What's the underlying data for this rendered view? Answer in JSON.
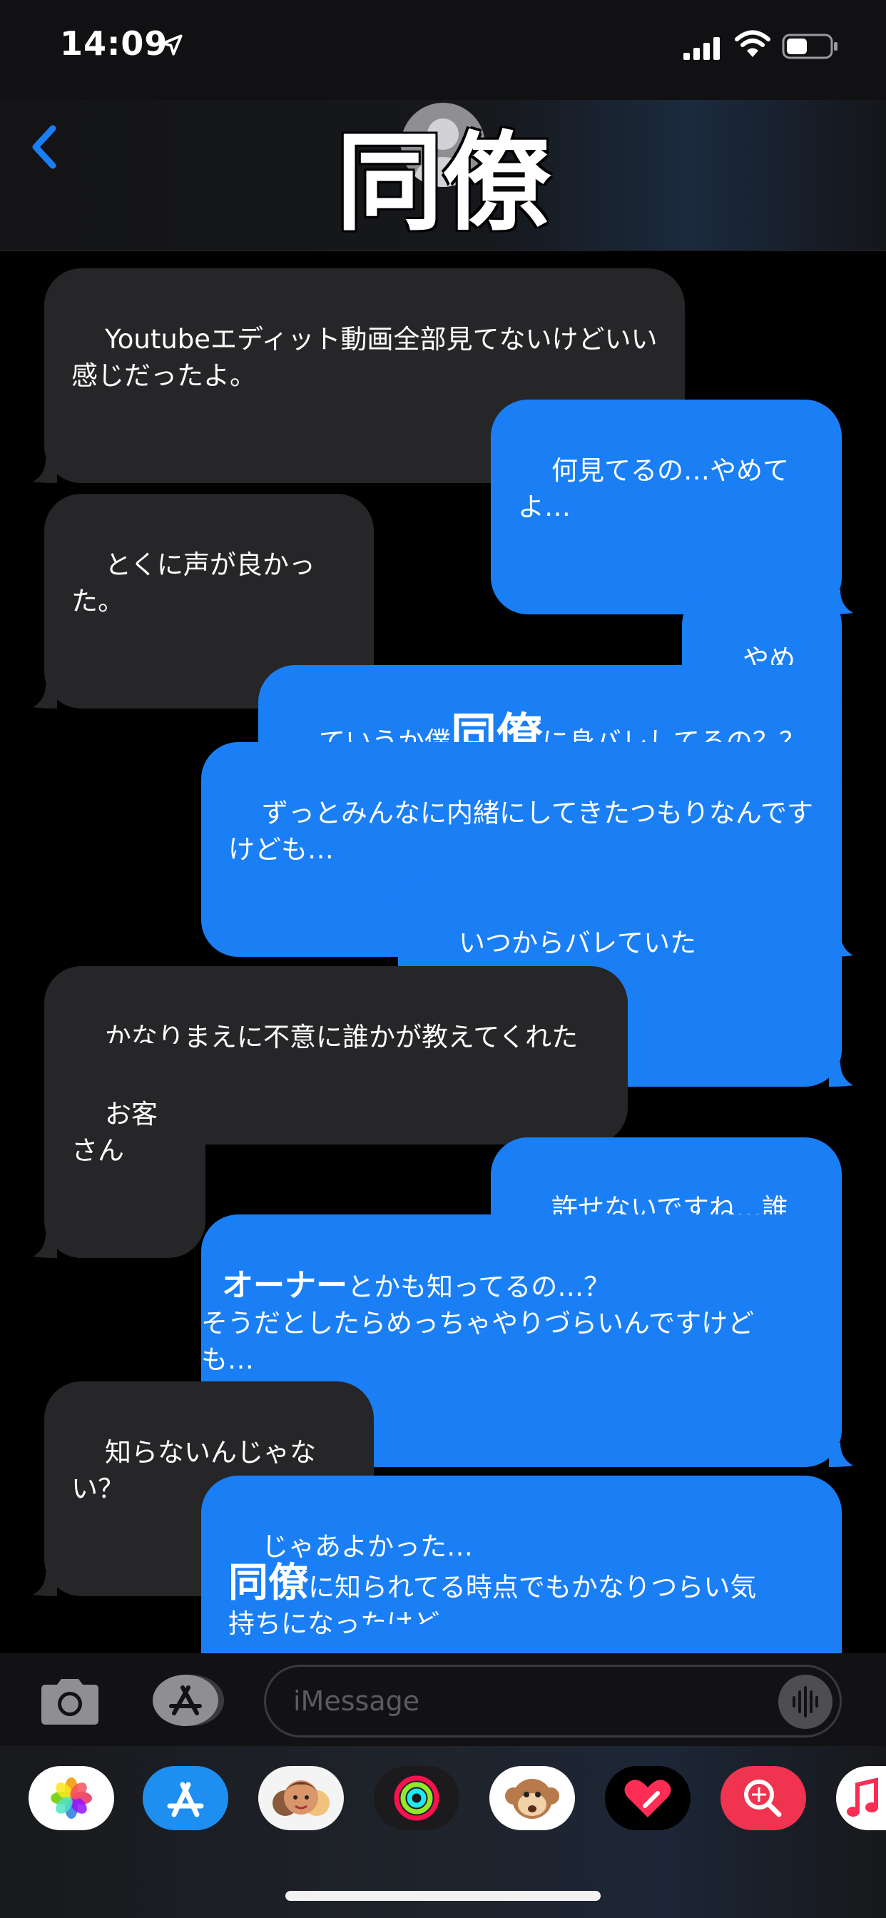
{
  "status_bar": {
    "time": "14:09",
    "icons": [
      "location-arrow-icon",
      "cellular-signal-icon",
      "wifi-icon",
      "battery-icon"
    ]
  },
  "nav": {
    "back_icon": "chevron-left-icon",
    "contact_name": "同僚",
    "accent_color": "#1a7ff5"
  },
  "messages": [
    {
      "direction": "incoming",
      "text": "Youtubeエディット動画全部見てないけどいい\n感じだったよ。"
    },
    {
      "direction": "outgoing",
      "text": "何見てるの…やめてよ…"
    },
    {
      "direction": "incoming",
      "text": "とくに声が良かった。"
    },
    {
      "direction": "outgoing",
      "text": "やめろ…"
    },
    {
      "direction": "outgoing",
      "text_before": "ていうか僕",
      "name_overlay": "同僚",
      "text_after": "に身バレしてるの？？"
    },
    {
      "direction": "outgoing",
      "text": "ずっとみんなに内緒にしてきたつもりなんです\nけども…"
    },
    {
      "direction": "outgoing",
      "text": "いつからバレていたの？？？？"
    },
    {
      "direction": "incoming",
      "text": "かなりまえに不意に誰かが教えてくれたよ"
    },
    {
      "direction": "incoming",
      "text": "お客さん"
    },
    {
      "direction": "outgoing",
      "text": "許せないですね…誰だ…"
    },
    {
      "direction": "outgoing",
      "name_overlay": "オーナー",
      "text_after": "とかも知ってるの…？\nそうだとしたらめっちゃやりづらいんですけど\nも…"
    },
    {
      "direction": "incoming",
      "text": "知らないんじゃない？"
    },
    {
      "direction": "outgoing",
      "text_before": "じゃあよかった…\n",
      "name_overlay": "同僚",
      "text_after": "に知られてる時点でもかなりつらい気\n持ちになったけど…"
    }
  ],
  "input": {
    "placeholder": "iMessage",
    "camera_icon": "camera-icon",
    "apps_icon": "app-store-icon",
    "audio_icon": "audio-waveform-icon"
  },
  "app_drawer": {
    "apps": [
      "photos-icon",
      "app-store-icon",
      "memoji-icon",
      "activity-rings-icon",
      "animoji-monkey-icon",
      "digital-touch-heart-icon",
      "image-search-icon",
      "music-icon"
    ]
  }
}
